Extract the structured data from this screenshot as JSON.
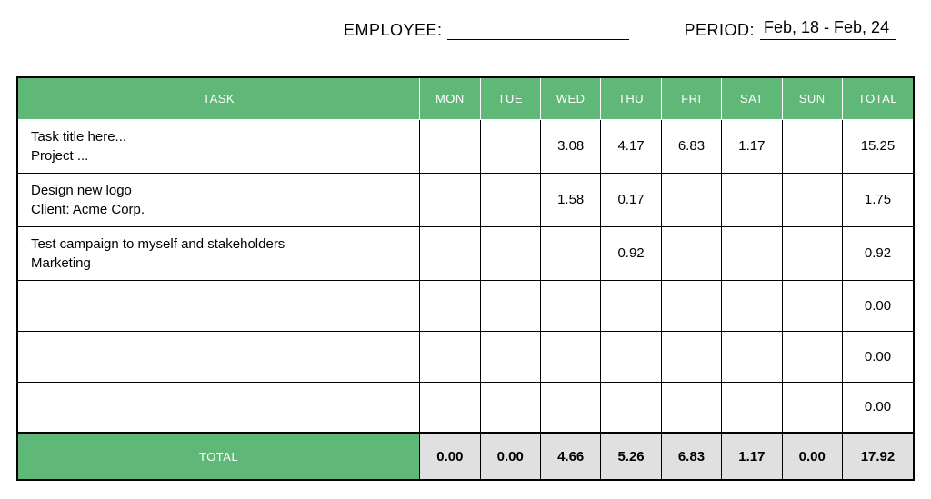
{
  "header": {
    "employee_label": "EMPLOYEE:",
    "employee_value": "",
    "period_label": "PERIOD:",
    "period_value": "Feb, 18 - Feb, 24"
  },
  "columns": {
    "task": "TASK",
    "mon": "MON",
    "tue": "TUE",
    "wed": "WED",
    "thu": "THU",
    "fri": "FRI",
    "sat": "SAT",
    "sun": "SUN",
    "total": "TOTAL"
  },
  "rows": [
    {
      "title": "Task title here...",
      "sub": "Project ...",
      "mon": "",
      "tue": "",
      "wed": "3.08",
      "thu": "4.17",
      "fri": "6.83",
      "sat": "1.17",
      "sun": "",
      "total": "15.25"
    },
    {
      "title": "Design new logo",
      "sub": "Client: Acme Corp.",
      "mon": "",
      "tue": "",
      "wed": "1.58",
      "thu": "0.17",
      "fri": "",
      "sat": "",
      "sun": "",
      "total": "1.75"
    },
    {
      "title": "Test campaign to myself and stakeholders",
      "sub": "Marketing",
      "mon": "",
      "tue": "",
      "wed": "",
      "thu": "0.92",
      "fri": "",
      "sat": "",
      "sun": "",
      "total": "0.92"
    },
    {
      "title": "",
      "sub": "",
      "mon": "",
      "tue": "",
      "wed": "",
      "thu": "",
      "fri": "",
      "sat": "",
      "sun": "",
      "total": "0.00"
    },
    {
      "title": "",
      "sub": "",
      "mon": "",
      "tue": "",
      "wed": "",
      "thu": "",
      "fri": "",
      "sat": "",
      "sun": "",
      "total": "0.00"
    },
    {
      "title": "",
      "sub": "",
      "mon": "",
      "tue": "",
      "wed": "",
      "thu": "",
      "fri": "",
      "sat": "",
      "sun": "",
      "total": "0.00"
    }
  ],
  "footer": {
    "label": "TOTAL",
    "mon": "0.00",
    "tue": "0.00",
    "wed": "4.66",
    "thu": "5.26",
    "fri": "6.83",
    "sat": "1.17",
    "sun": "0.00",
    "total": "17.92"
  }
}
